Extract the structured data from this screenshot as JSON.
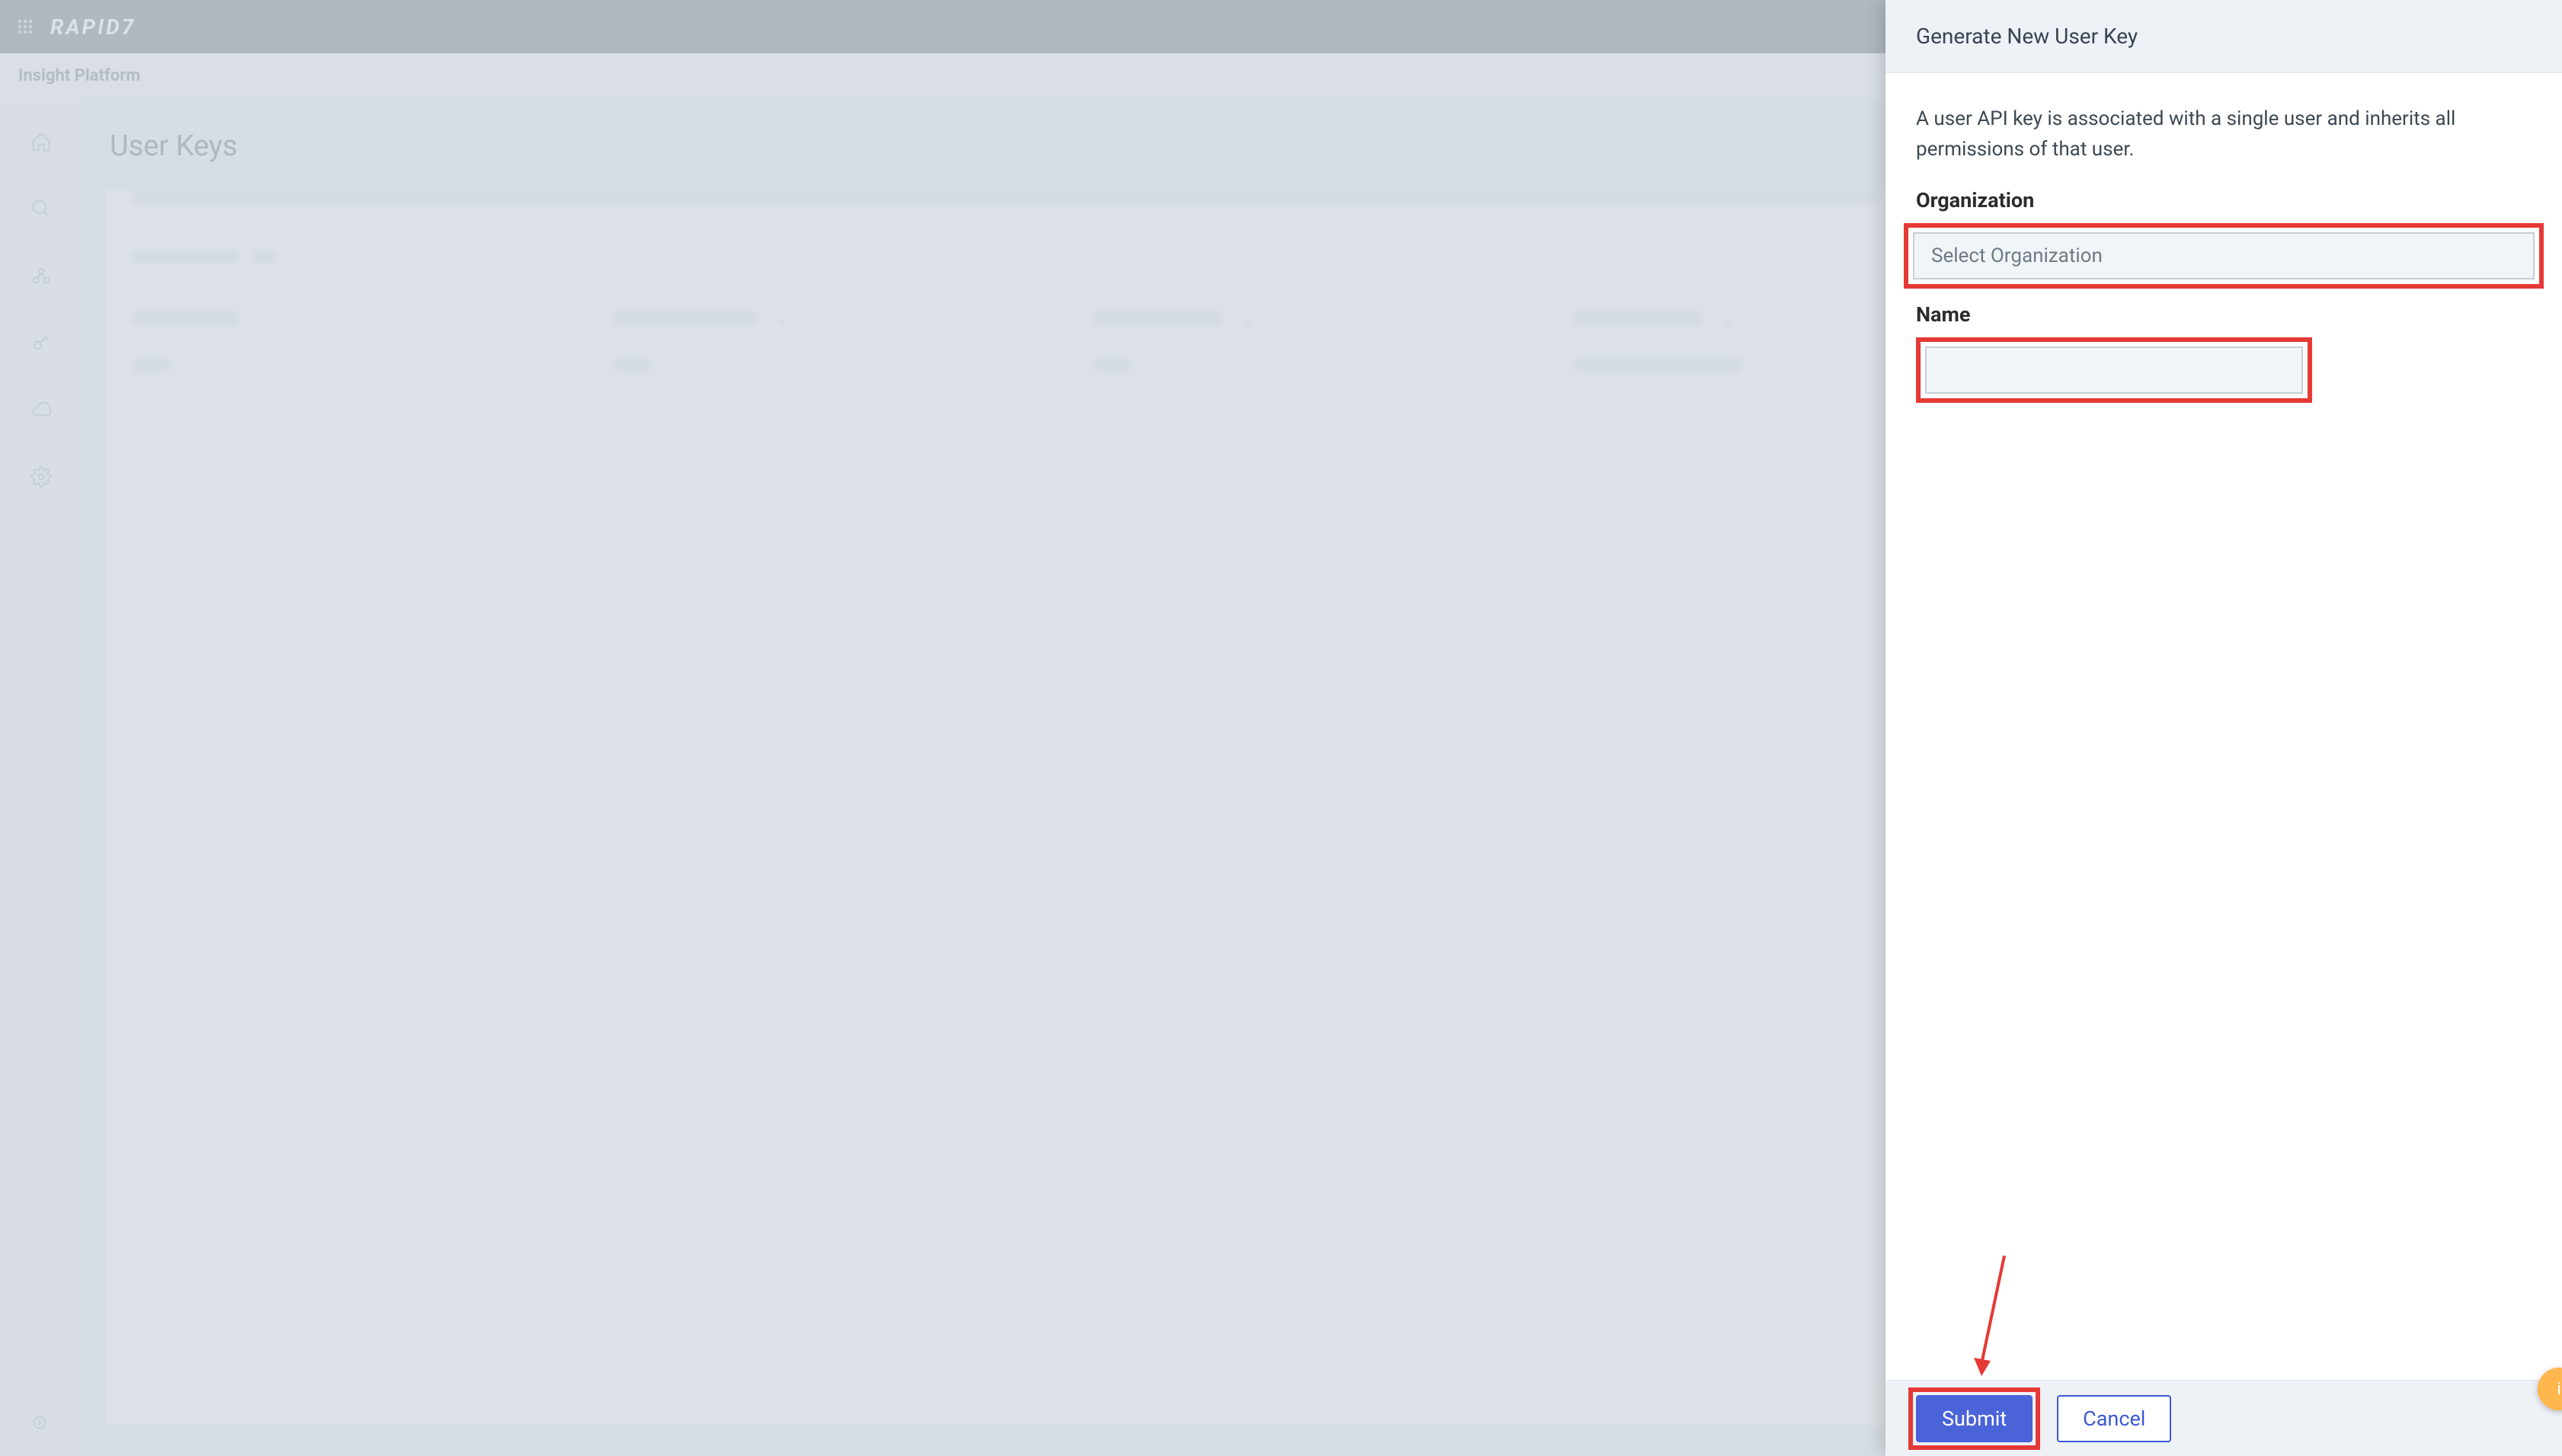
{
  "header": {
    "logo_text": "RAPID7",
    "platform_label": "Insight Platform"
  },
  "sidenav": {
    "items": [
      "home",
      "search",
      "dashboard",
      "key",
      "cloud",
      "settings"
    ]
  },
  "page": {
    "title": "User Keys"
  },
  "panel": {
    "title": "Generate New User Key",
    "description": "A user API key is associated with a single user and inherits all permissions of that user.",
    "org_label": "Organization",
    "org_placeholder": "Select Organization",
    "name_label": "Name",
    "name_value": "",
    "submit_label": "Submit",
    "cancel_label": "Cancel"
  },
  "help_bubble": {
    "text": "i"
  },
  "colors": {
    "highlight": "#e53935",
    "primary": "#4a63d8"
  }
}
